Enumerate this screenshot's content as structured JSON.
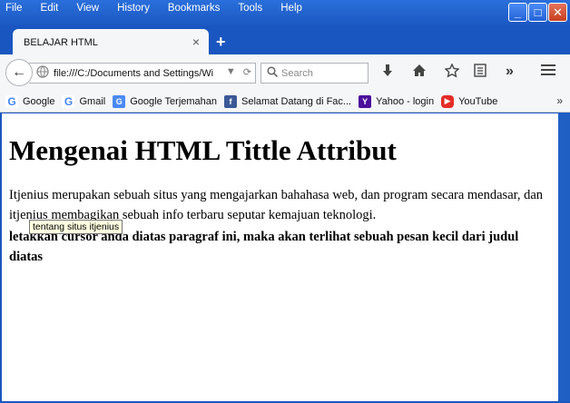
{
  "menubar": {
    "items": [
      {
        "label": "File"
      },
      {
        "label": "Edit"
      },
      {
        "label": "View"
      },
      {
        "label": "History"
      },
      {
        "label": "Bookmarks"
      },
      {
        "label": "Tools"
      },
      {
        "label": "Help"
      }
    ]
  },
  "window": {
    "minimize": "_",
    "maximize": "□",
    "close": "✕"
  },
  "tab": {
    "title": "BELAJAR HTML",
    "close": "×",
    "new_tab": "+"
  },
  "navbar": {
    "url": "file:///C:/Documents and Settings/Wi",
    "search_placeholder": "Search"
  },
  "bookmarks": [
    {
      "label": "Google",
      "icon": "google-icon"
    },
    {
      "label": "Gmail",
      "icon": "google-icon"
    },
    {
      "label": "Google Terjemahan",
      "icon": "google-translate-icon"
    },
    {
      "label": "Selamat Datang di Fac...",
      "icon": "facebook-icon"
    },
    {
      "label": "Yahoo - login",
      "icon": "yahoo-icon"
    },
    {
      "label": "YouTube",
      "icon": "youtube-icon"
    }
  ],
  "page": {
    "heading": "Mengenai HTML Tittle Attribut",
    "paragraph": "Itjenius merupakan sebuah situs yang mengajarkan bahahasa web, dan program secara mendasar, dan itjenius membagikan sebuah info terbaru seputar kemajuan teknologi.",
    "tooltip": "tentang situs itjenius",
    "instruction": "letakkan cursor anda diatas paragraf ini, maka akan terlihat sebuah pesan kecil dari judul diatas"
  },
  "colors": {
    "titlebar": "#1a56c0",
    "toolbar": "#f5f6f7",
    "tooltip_bg": "#ffffe1"
  }
}
